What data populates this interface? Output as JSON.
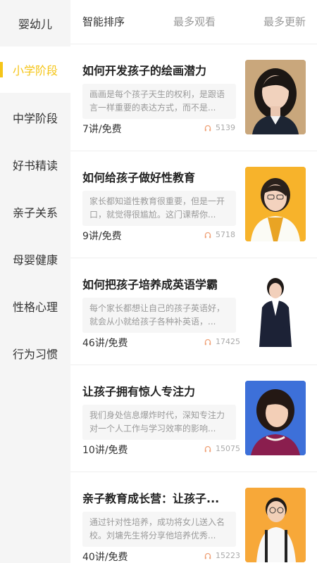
{
  "sidebar": {
    "items": [
      {
        "label": "婴幼儿",
        "active": false
      },
      {
        "label": "小学阶段",
        "active": true
      },
      {
        "label": "中学阶段",
        "active": false
      },
      {
        "label": "好书精读",
        "active": false
      },
      {
        "label": "亲子关系",
        "active": false
      },
      {
        "label": "母婴健康",
        "active": false
      },
      {
        "label": "性格心理",
        "active": false
      },
      {
        "label": "行为习惯",
        "active": false
      }
    ]
  },
  "sort_tabs": [
    {
      "label": "智能排序",
      "active": true
    },
    {
      "label": "最多观看",
      "active": false
    },
    {
      "label": "最多更新",
      "active": false
    }
  ],
  "courses": [
    {
      "title": "如何开发孩子的绘画潜力",
      "desc": "画画是每个孩子天生的权利，是跟语言一样重要的表达方式，而不是...",
      "lessons": "7讲/免费",
      "plays": "5139",
      "thumb_bg": "#c7a57a"
    },
    {
      "title": "如何给孩子做好性教育",
      "desc": "家长都知道性教育很重要，但是一开口，就觉得很尴尬。这门课帮你...",
      "lessons": "9讲/免费",
      "plays": "5718",
      "thumb_bg": "#f7b32b"
    },
    {
      "title": "如何把孩子培养成英语学霸",
      "desc": "每个家长都想让自己的孩子英语好，就会从小就给孩子各种补英语，...",
      "lessons": "46讲/免费",
      "plays": "17425",
      "thumb_bg": "#ffffff"
    },
    {
      "title": "让孩子拥有惊人专注力",
      "desc": "我们身处信息爆炸时代，深知专注力对一个人工作与学习效率的影响...",
      "lessons": "10讲/免费",
      "plays": "15075",
      "thumb_bg": "#3b6fd8"
    },
    {
      "title": "亲子教育成长营：让孩子...",
      "desc": "通过针对性培养，成功将女儿送入名校。刘墉先生将分享他培养优秀...",
      "lessons": "40讲/免费",
      "plays": "15223",
      "thumb_bg": "#f7a839"
    }
  ],
  "colors": {
    "accent": "#f5c518",
    "sidebar_bg": "#f5f5f5",
    "muted": "#999999"
  },
  "icons": {
    "plays": "headphones-icon"
  }
}
